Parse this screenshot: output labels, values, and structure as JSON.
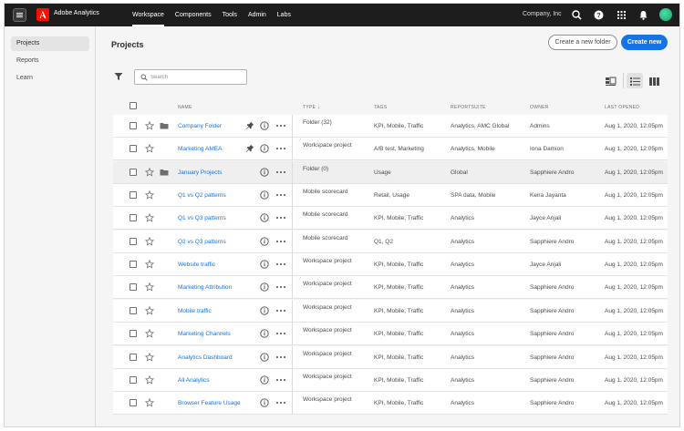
{
  "app": {
    "name": "Adobe Analytics",
    "company": "Company, Inc",
    "nav": [
      "Workspace",
      "Components",
      "Tools",
      "Admin",
      "Labs"
    ],
    "active_nav": "Workspace"
  },
  "sidebar": {
    "items": [
      {
        "label": "Projects",
        "active": true
      },
      {
        "label": "Reports",
        "active": false
      },
      {
        "label": "Learn",
        "active": false
      }
    ]
  },
  "main": {
    "title": "Projects",
    "new_folder_label": "Create a new folder",
    "create_new_label": "Create new",
    "search_placeholder": "Search",
    "columns": {
      "name": "NAME",
      "type": "TYPE",
      "tags": "TAGS",
      "reportsuite": "REPORTSUITE",
      "owner": "OWNER",
      "last_opened": "LAST OPENED"
    },
    "rows": [
      {
        "name": "Company Folder",
        "folder": true,
        "pinned": true,
        "type": "Folder (32)",
        "tags": "KPI, Mobile, Traffic",
        "reportsuite": "Analytics, AMC Global",
        "owner": "Admins",
        "last_opened": "Aug 1, 2020, 12:05pm"
      },
      {
        "name": "Marketing AMEA",
        "folder": false,
        "pinned": true,
        "type": "Workspace project",
        "tags": "A/B test, Marketing",
        "reportsuite": "Analytics, Mobile",
        "owner": "Iona Damion",
        "last_opened": "Aug 1, 2020, 12:05pm"
      },
      {
        "name": "January Projects",
        "folder": true,
        "pinned": false,
        "selected": true,
        "type": "Folder (0)",
        "tags": "Usage",
        "reportsuite": "Global",
        "owner": "Sapphiere Andro",
        "last_opened": "Aug 1, 2020, 12:05pm"
      },
      {
        "name": "Q1 vs Q2 patterns",
        "folder": false,
        "pinned": false,
        "type": "Mobile scorecard",
        "tags": "Retail, Usage",
        "reportsuite": "SPA data, Mobile",
        "owner": "Keira Jayanta",
        "last_opened": "Aug 1, 2020, 12:05pm"
      },
      {
        "name": "Q1 vs Q3 patterns",
        "folder": false,
        "pinned": false,
        "type": "Mobile scorecard",
        "tags": "KPI, Mobile, Traffic",
        "reportsuite": "Analytics",
        "owner": "Jayce Anjali",
        "last_opened": "Aug 1, 2020, 12:05pm"
      },
      {
        "name": "Q2 vs Q3 patterns",
        "folder": false,
        "pinned": false,
        "type": "Mobile scorecard",
        "tags": "Q1, Q2",
        "reportsuite": "Analytics",
        "owner": "Sapphiere Andro",
        "last_opened": "Aug 1, 2020, 12:05pm"
      },
      {
        "name": "Website traffic",
        "folder": false,
        "pinned": false,
        "type": "Workspace project",
        "tags": "KPI, Mobile, Traffic",
        "reportsuite": "Analytics",
        "owner": "Jayce Anjali",
        "last_opened": "Aug 1, 2020, 12:05pm"
      },
      {
        "name": "Marketing Attribution",
        "folder": false,
        "pinned": false,
        "type": "Workspace project",
        "tags": "KPI, Mobile, Traffic",
        "reportsuite": "Analytics",
        "owner": "Sapphiere Andro",
        "last_opened": "Aug 1, 2020, 12:05pm"
      },
      {
        "name": "Mobile traffic",
        "folder": false,
        "pinned": false,
        "type": "Workspace project",
        "tags": "KPI, Mobile, Traffic",
        "reportsuite": "Analytics",
        "owner": "Sapphiere Andro",
        "last_opened": "Aug 1, 2020, 12:05pm"
      },
      {
        "name": "Marketing Channels",
        "folder": false,
        "pinned": false,
        "type": "Workspace project",
        "tags": "KPI, Mobile, Traffic",
        "reportsuite": "Analytics",
        "owner": "Sapphiere Andro",
        "last_opened": "Aug 1, 2020, 12:05pm"
      },
      {
        "name": "Analytics Dashboard",
        "folder": false,
        "pinned": false,
        "type": "Workspace project",
        "tags": "KPI, Mobile, Traffic",
        "reportsuite": "Analytics",
        "owner": "Sapphiere Andro",
        "last_opened": "Aug 1, 2020, 12:05pm"
      },
      {
        "name": "All Analytics",
        "folder": false,
        "pinned": false,
        "type": "Workspace project",
        "tags": "KPI, Mobile, Traffic",
        "reportsuite": "Analytics",
        "owner": "Sapphiere Andro",
        "last_opened": "Aug 1, 2020, 12:05pm"
      },
      {
        "name": "Browser Feature Usage",
        "folder": false,
        "pinned": false,
        "type": "Workspace project",
        "tags": "KPI, Mobile, Traffic",
        "reportsuite": "Analytics",
        "owner": "Sapphiere Andro",
        "last_opened": "Aug 1, 2020, 12:05pm"
      }
    ]
  },
  "icons": {
    "menu": "hamburger-icon",
    "logo": "adobe-logo-icon",
    "search": "search-icon",
    "help": "help-icon",
    "apps": "app-grid-icon",
    "notifications": "bell-icon",
    "filter": "filter-icon",
    "views": [
      "card-view-icon",
      "list-view-icon",
      "column-view-icon"
    ],
    "row": [
      "star-icon",
      "folder-icon",
      "pin-icon",
      "info-icon",
      "more-icon"
    ]
  },
  "colors": {
    "accent": "#1473e6",
    "topbar": "#1d1d1d",
    "brand": "#fa0f00",
    "avatar": "#12a26a"
  }
}
